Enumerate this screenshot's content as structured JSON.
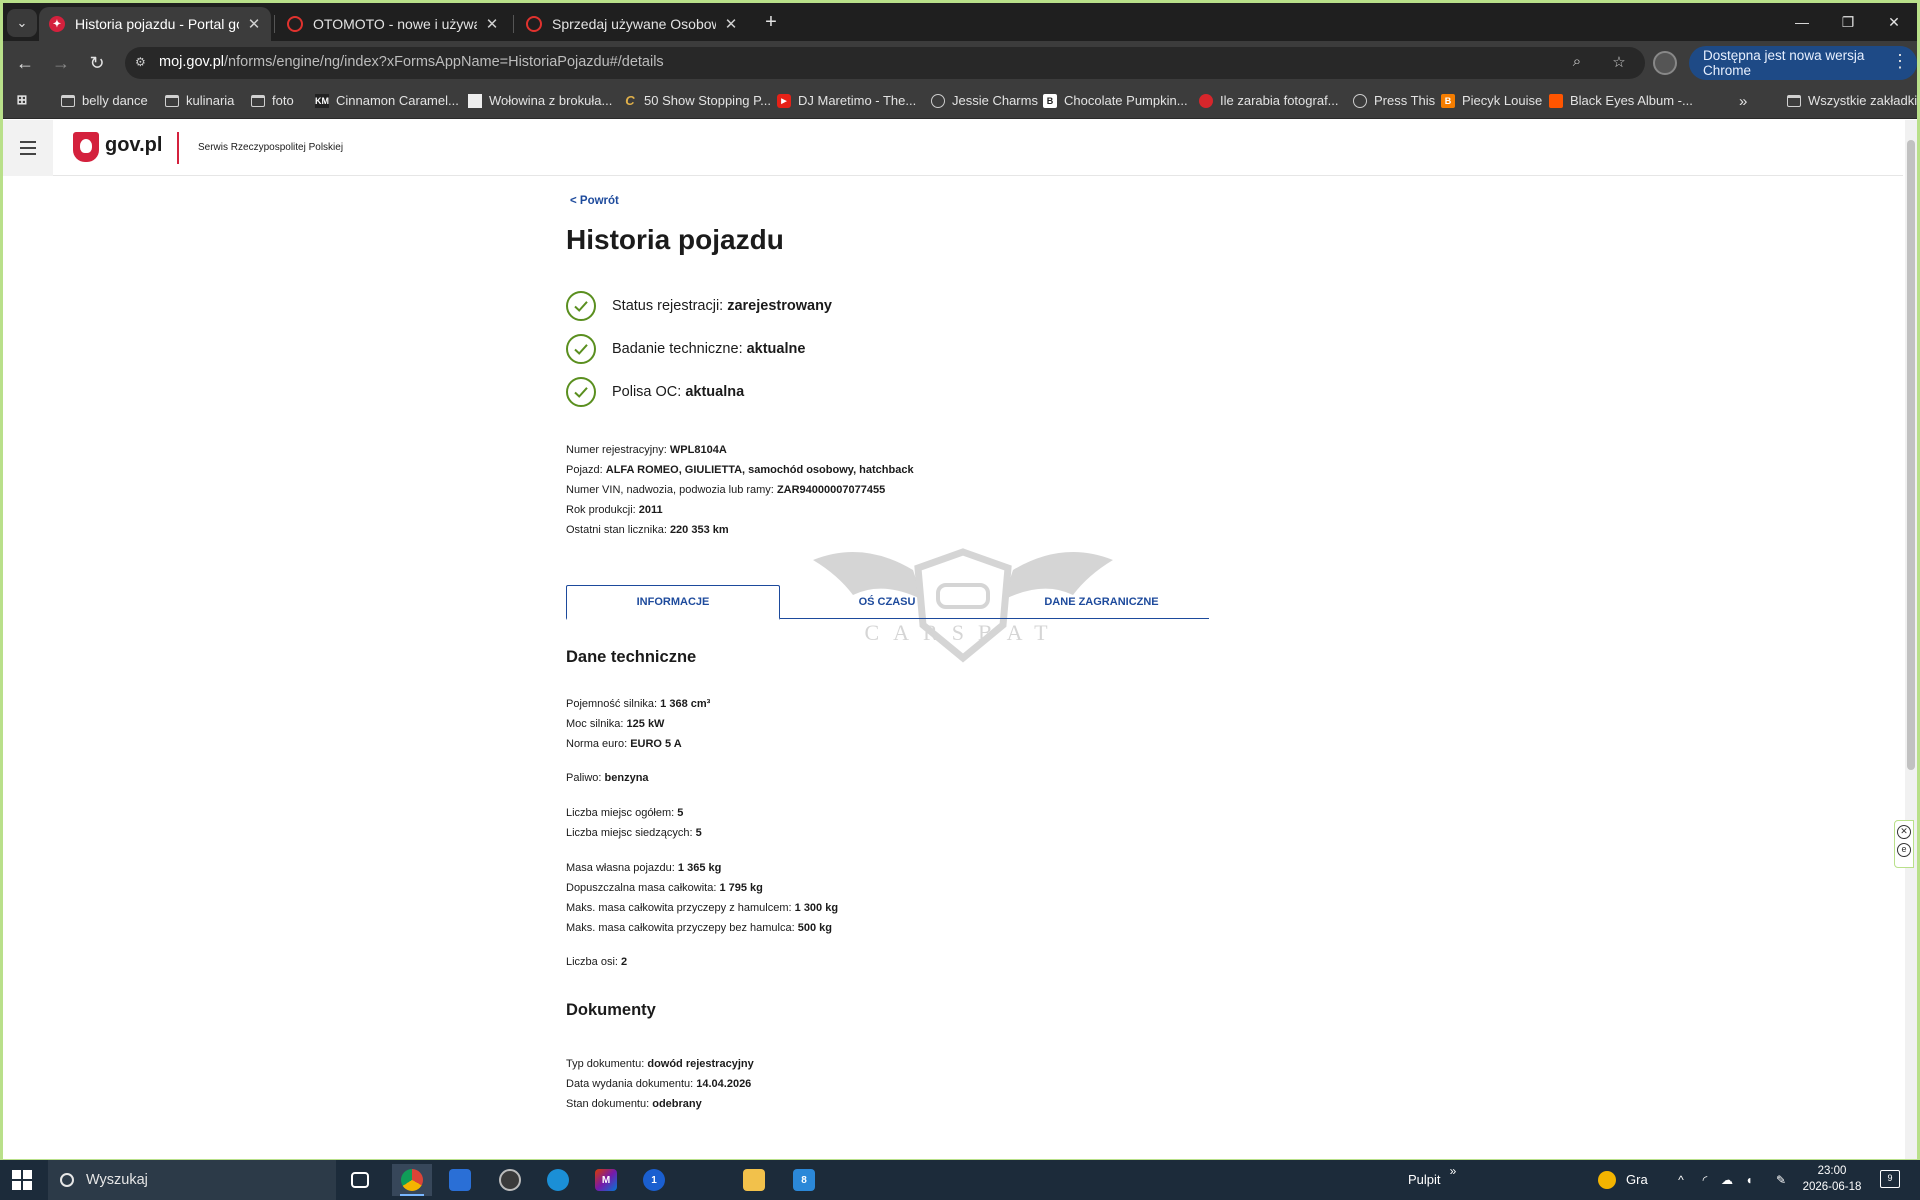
{
  "browser": {
    "tabs": [
      {
        "title": "Historia pojazdu - Portal gov.pl",
        "active": true
      },
      {
        "title": "OTOMOTO - nowe i używane sa",
        "active": false
      },
      {
        "title": "Sprzedaj używane Osobowe | O",
        "active": false
      }
    ],
    "url_host": "moj.gov.pl",
    "url_path": "/nforms/engine/ng/index?xFormsAppName=HistoriaPojazdu#/details",
    "update_chip": "Dostępna jest nowa wersja Chrome",
    "bookmarks": [
      {
        "label": "belly dance",
        "icon": "folder"
      },
      {
        "label": "kulinaria",
        "icon": "folder"
      },
      {
        "label": "foto",
        "icon": "folder"
      },
      {
        "label": "Cinnamon Caramel...",
        "icon": "km"
      },
      {
        "label": "Wołowina z brokuła...",
        "icon": "page"
      },
      {
        "label": "50 Show Stopping P...",
        "icon": "c-logo"
      },
      {
        "label": "DJ Maretimo - The...",
        "icon": "youtube"
      },
      {
        "label": "Jessie Charms",
        "icon": "globe"
      },
      {
        "label": "Chocolate Pumpkin...",
        "icon": "b-logo"
      },
      {
        "label": "Ile zarabia fotograf...",
        "icon": "red-logo"
      },
      {
        "label": "Press This",
        "icon": "globe"
      },
      {
        "label": "Piecyk Louise",
        "icon": "blogger"
      },
      {
        "label": "Black Eyes Album -...",
        "icon": "soundcloud"
      }
    ],
    "all_bookmarks": "Wszystkie zakładki"
  },
  "header": {
    "logo_text": "gov.pl",
    "service_text": "Serwis Rzeczypospolitej Polskiej"
  },
  "page": {
    "back": "< Powrót",
    "title": "Historia pojazdu",
    "statuses": [
      {
        "label": "Status rejestracji:",
        "value": "zarejestrowany"
      },
      {
        "label": "Badanie techniczne:",
        "value": "aktualne"
      },
      {
        "label": "Polisa OC:",
        "value": "aktualna"
      }
    ],
    "vehicle": [
      {
        "label": "Numer rejestracyjny:",
        "value": "WPL8104A"
      },
      {
        "label": "Pojazd:",
        "value": "ALFA ROMEO, GIULIETTA, samochód osobowy, hatchback"
      },
      {
        "label": "Numer VIN, nadwozia, podwozia lub ramy:",
        "value": "ZAR94000007077455"
      },
      {
        "label": "Rok produkcji:",
        "value": "2011"
      },
      {
        "label": "Ostatni stan licznika:",
        "value": "220 353 km"
      }
    ],
    "tabs": [
      "INFORMACJE",
      "OŚ CZASU",
      "DANE ZAGRANICZNE"
    ],
    "watermark": "CARSBAT",
    "tech_title": "Dane techniczne",
    "tech": [
      {
        "label": "Pojemność silnika:",
        "value": "1 368 cm³"
      },
      {
        "label": "Moc silnika:",
        "value": "125 kW"
      },
      {
        "label": "Norma euro:",
        "value": "EURO 5 A"
      },
      {
        "label": "Paliwo:",
        "value": "benzyna"
      },
      {
        "label": "Liczba miejsc ogółem:",
        "value": "5"
      },
      {
        "label": "Liczba miejsc siedzących:",
        "value": "5"
      },
      {
        "label": "Masa własna pojazdu:",
        "value": "1 365 kg"
      },
      {
        "label": "Dopuszczalna masa całkowita:",
        "value": "1 795 kg"
      },
      {
        "label": "Maks. masa całkowita przyczepy z hamulcem:",
        "value": "1 300 kg"
      },
      {
        "label": "Maks. masa całkowita przyczepy bez hamulca:",
        "value": "500 kg"
      },
      {
        "label": "Liczba osi:",
        "value": "2"
      }
    ],
    "docs_title": "Dokumenty",
    "docs": [
      {
        "label": "Typ dokumentu:",
        "value": "dowód rejestracyjny"
      },
      {
        "label": "Data wydania dokumentu:",
        "value": "14.04.2026"
      },
      {
        "label": "Stan dokumentu:",
        "value": "odebrany"
      }
    ]
  },
  "taskbar": {
    "search_placeholder": "Wyszukaj",
    "pulpit": "Pulpit",
    "weather": "Gra",
    "time": "23:00",
    "date": "2026-06-18",
    "notifications": "9",
    "app_badge": "8"
  },
  "colors": {
    "accent": "#1d4a9c",
    "check_green": "#5a8f1f",
    "gov_red": "#d4213d",
    "desktop_border": "#b9e08a"
  }
}
